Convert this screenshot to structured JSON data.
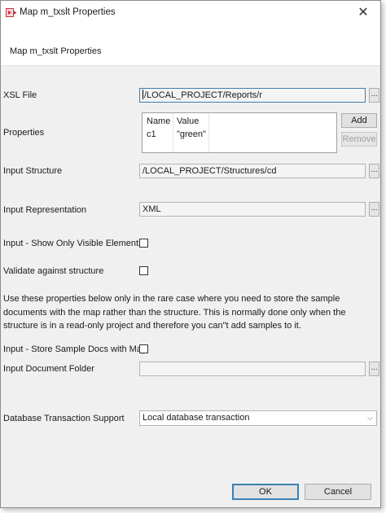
{
  "window": {
    "title": "Map m_txslt Properties",
    "close_symbol": "✕"
  },
  "header": {
    "title": "Map m_txslt Properties"
  },
  "form": {
    "xsl_file": {
      "label": "XSL File",
      "value": "/LOCAL_PROJECT/Reports/r",
      "browse": "..."
    },
    "properties": {
      "label": "Properties",
      "columns": [
        "Name",
        "Value"
      ],
      "rows": [
        {
          "name": "c1",
          "value": "\"green\""
        }
      ],
      "add_label": "Add",
      "remove_label": "Remove"
    },
    "input_structure": {
      "label": "Input Structure",
      "value": "/LOCAL_PROJECT/Structures/cd",
      "browse": "..."
    },
    "input_representation": {
      "label": "Input Representation",
      "value": "XML",
      "browse": "..."
    },
    "show_visible": {
      "label": "Input - Show Only Visible Elements",
      "checked": false
    },
    "validate": {
      "label": "Validate against structure",
      "checked": false
    },
    "info_text": "Use these properties below only in the rare case where you need to store the sample documents with the map rather than the structure. This is normally done only when the structure is in a read-only project and therefore you can\"t add samples to it.",
    "store_samples": {
      "label": "Input - Store Sample Docs with Map",
      "checked": false
    },
    "input_document_folder": {
      "label": "Input Document Folder",
      "value": "",
      "browse": "..."
    },
    "db_transaction": {
      "label": "Database Transaction Support",
      "selected": "Local database transaction"
    }
  },
  "footer": {
    "ok_label": "OK",
    "cancel_label": "Cancel"
  },
  "colors": {
    "dialog_bg": "#f0f0f0",
    "focus_border": "#3c7fb1",
    "icon_red": "#c9303b"
  }
}
